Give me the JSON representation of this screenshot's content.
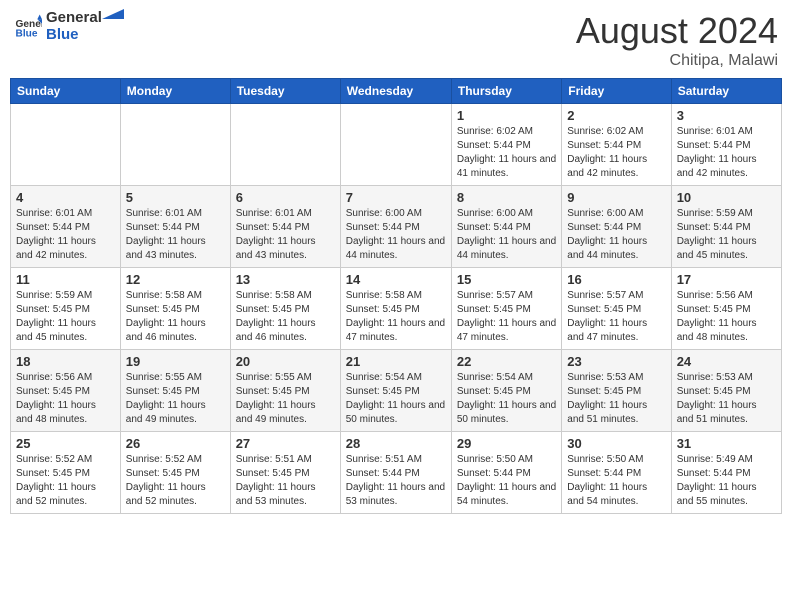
{
  "header": {
    "logo_general": "General",
    "logo_blue": "Blue",
    "month_title": "August 2024",
    "subtitle": "Chitipa, Malawi"
  },
  "days_of_week": [
    "Sunday",
    "Monday",
    "Tuesday",
    "Wednesday",
    "Thursday",
    "Friday",
    "Saturday"
  ],
  "weeks": [
    [
      {
        "day": "",
        "sunrise": "",
        "sunset": "",
        "daylight": ""
      },
      {
        "day": "",
        "sunrise": "",
        "sunset": "",
        "daylight": ""
      },
      {
        "day": "",
        "sunrise": "",
        "sunset": "",
        "daylight": ""
      },
      {
        "day": "",
        "sunrise": "",
        "sunset": "",
        "daylight": ""
      },
      {
        "day": "1",
        "sunrise": "6:02 AM",
        "sunset": "5:44 PM",
        "daylight": "11 hours and 41 minutes."
      },
      {
        "day": "2",
        "sunrise": "6:02 AM",
        "sunset": "5:44 PM",
        "daylight": "11 hours and 42 minutes."
      },
      {
        "day": "3",
        "sunrise": "6:01 AM",
        "sunset": "5:44 PM",
        "daylight": "11 hours and 42 minutes."
      }
    ],
    [
      {
        "day": "4",
        "sunrise": "6:01 AM",
        "sunset": "5:44 PM",
        "daylight": "11 hours and 42 minutes."
      },
      {
        "day": "5",
        "sunrise": "6:01 AM",
        "sunset": "5:44 PM",
        "daylight": "11 hours and 43 minutes."
      },
      {
        "day": "6",
        "sunrise": "6:01 AM",
        "sunset": "5:44 PM",
        "daylight": "11 hours and 43 minutes."
      },
      {
        "day": "7",
        "sunrise": "6:00 AM",
        "sunset": "5:44 PM",
        "daylight": "11 hours and 44 minutes."
      },
      {
        "day": "8",
        "sunrise": "6:00 AM",
        "sunset": "5:44 PM",
        "daylight": "11 hours and 44 minutes."
      },
      {
        "day": "9",
        "sunrise": "6:00 AM",
        "sunset": "5:44 PM",
        "daylight": "11 hours and 44 minutes."
      },
      {
        "day": "10",
        "sunrise": "5:59 AM",
        "sunset": "5:44 PM",
        "daylight": "11 hours and 45 minutes."
      }
    ],
    [
      {
        "day": "11",
        "sunrise": "5:59 AM",
        "sunset": "5:45 PM",
        "daylight": "11 hours and 45 minutes."
      },
      {
        "day": "12",
        "sunrise": "5:58 AM",
        "sunset": "5:45 PM",
        "daylight": "11 hours and 46 minutes."
      },
      {
        "day": "13",
        "sunrise": "5:58 AM",
        "sunset": "5:45 PM",
        "daylight": "11 hours and 46 minutes."
      },
      {
        "day": "14",
        "sunrise": "5:58 AM",
        "sunset": "5:45 PM",
        "daylight": "11 hours and 47 minutes."
      },
      {
        "day": "15",
        "sunrise": "5:57 AM",
        "sunset": "5:45 PM",
        "daylight": "11 hours and 47 minutes."
      },
      {
        "day": "16",
        "sunrise": "5:57 AM",
        "sunset": "5:45 PM",
        "daylight": "11 hours and 47 minutes."
      },
      {
        "day": "17",
        "sunrise": "5:56 AM",
        "sunset": "5:45 PM",
        "daylight": "11 hours and 48 minutes."
      }
    ],
    [
      {
        "day": "18",
        "sunrise": "5:56 AM",
        "sunset": "5:45 PM",
        "daylight": "11 hours and 48 minutes."
      },
      {
        "day": "19",
        "sunrise": "5:55 AM",
        "sunset": "5:45 PM",
        "daylight": "11 hours and 49 minutes."
      },
      {
        "day": "20",
        "sunrise": "5:55 AM",
        "sunset": "5:45 PM",
        "daylight": "11 hours and 49 minutes."
      },
      {
        "day": "21",
        "sunrise": "5:54 AM",
        "sunset": "5:45 PM",
        "daylight": "11 hours and 50 minutes."
      },
      {
        "day": "22",
        "sunrise": "5:54 AM",
        "sunset": "5:45 PM",
        "daylight": "11 hours and 50 minutes."
      },
      {
        "day": "23",
        "sunrise": "5:53 AM",
        "sunset": "5:45 PM",
        "daylight": "11 hours and 51 minutes."
      },
      {
        "day": "24",
        "sunrise": "5:53 AM",
        "sunset": "5:45 PM",
        "daylight": "11 hours and 51 minutes."
      }
    ],
    [
      {
        "day": "25",
        "sunrise": "5:52 AM",
        "sunset": "5:45 PM",
        "daylight": "11 hours and 52 minutes."
      },
      {
        "day": "26",
        "sunrise": "5:52 AM",
        "sunset": "5:45 PM",
        "daylight": "11 hours and 52 minutes."
      },
      {
        "day": "27",
        "sunrise": "5:51 AM",
        "sunset": "5:45 PM",
        "daylight": "11 hours and 53 minutes."
      },
      {
        "day": "28",
        "sunrise": "5:51 AM",
        "sunset": "5:44 PM",
        "daylight": "11 hours and 53 minutes."
      },
      {
        "day": "29",
        "sunrise": "5:50 AM",
        "sunset": "5:44 PM",
        "daylight": "11 hours and 54 minutes."
      },
      {
        "day": "30",
        "sunrise": "5:50 AM",
        "sunset": "5:44 PM",
        "daylight": "11 hours and 54 minutes."
      },
      {
        "day": "31",
        "sunrise": "5:49 AM",
        "sunset": "5:44 PM",
        "daylight": "11 hours and 55 minutes."
      }
    ]
  ]
}
